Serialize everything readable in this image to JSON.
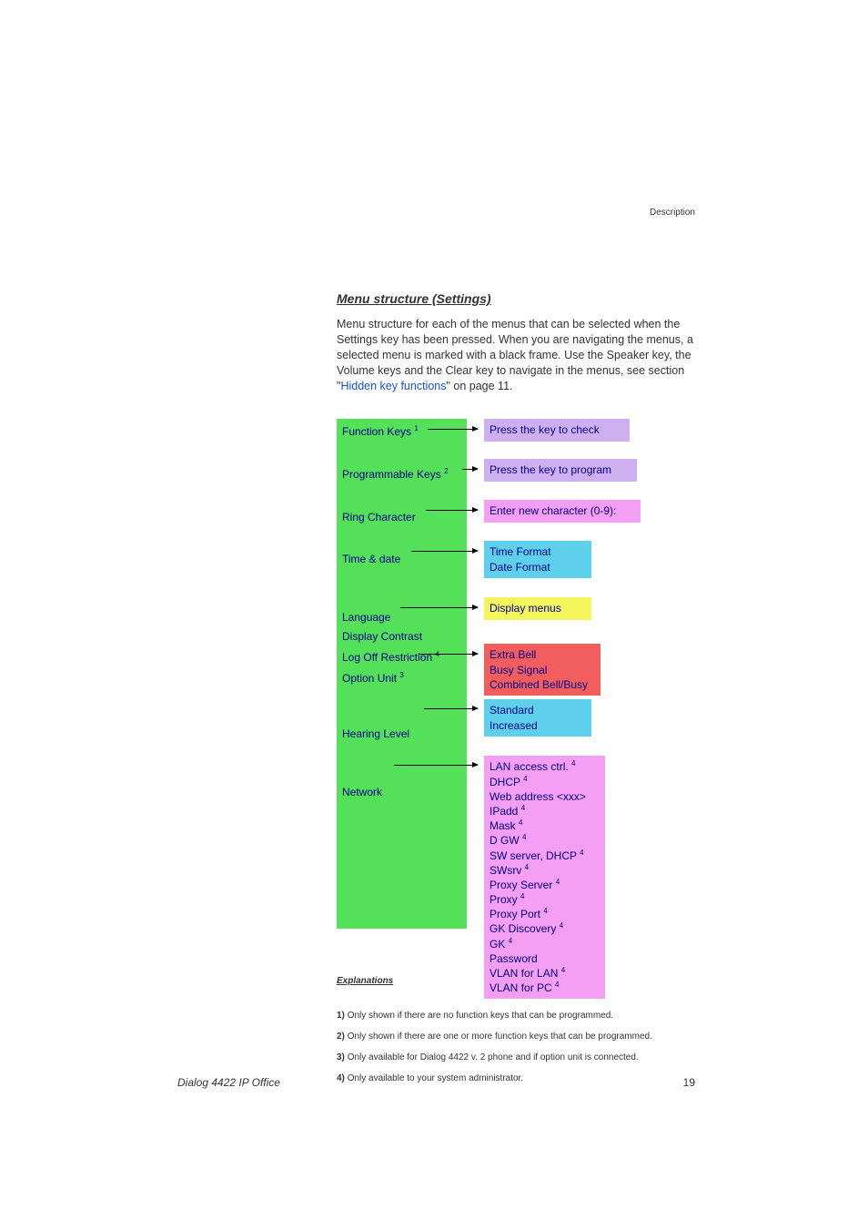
{
  "header": {
    "label": "Description"
  },
  "section": {
    "title": "Menu structure (Settings)",
    "intro_part1": "Menu structure for each of the menus that can be selected when the Settings key has been pressed. When you are navigating the menus, a selected menu is marked with a black frame. Use the Speaker key, the Volume keys and the Clear key to navigate in the menus, see section \"",
    "intro_link": "Hidden key functions",
    "intro_part2": "\" on page 11."
  },
  "menu": {
    "function_keys": "Function Keys",
    "function_keys_sup": "1",
    "programmable_keys": "Programmable Keys",
    "programmable_keys_sup": "2",
    "ring_character": "Ring Character",
    "time_date": "Time & date",
    "language": "Language",
    "display_contrast": "Display Contrast",
    "log_off_restriction": "Log Off Restriction",
    "log_off_restriction_sup": "4",
    "option_unit": "Option Unit",
    "option_unit_sup": "3",
    "hearing_level": "Hearing Level",
    "network": "Network"
  },
  "boxes": {
    "press_check": "Press the key to check",
    "press_program": "Press the key to program",
    "enter_char": "Enter new character (0-9):",
    "time_format": "Time Format",
    "date_format": "Date Format",
    "display_menus": "Display menus",
    "extra_bell": "Extra Bell",
    "busy_signal": "Busy Signal",
    "combined_bell": "Combined Bell/Busy",
    "standard": "Standard",
    "increased": "Increased",
    "lan_access": "LAN access ctrl.",
    "dhcp": "DHCP",
    "web_address": "Web address <xxx>",
    "ipadd": "IPadd",
    "mask": "Mask",
    "dgw": "D GW",
    "sw_server": "SW server, DHCP",
    "swsrv": "SWsrv",
    "proxy_server": "Proxy Server",
    "proxy": "Proxy",
    "proxy_port": "Proxy Port",
    "gk_discovery": "GK Discovery",
    "gk": "GK",
    "password": "Password",
    "vlan_lan": "VLAN for LAN",
    "vlan_pc": "VLAN for PC",
    "sup4": "4"
  },
  "explanations": {
    "title": "Explanations",
    "fn1_num": "1)",
    "fn1": "Only shown if there are no function keys that can be programmed.",
    "fn2_num": "2)",
    "fn2": "Only shown if there are one or more function keys that can be programmed.",
    "fn3_num": "3)",
    "fn3": "Only available for Dialog 4422 v. 2 phone and if option unit is connected.",
    "fn4_num": "4)",
    "fn4": "Only available to your system administrator."
  },
  "footer": {
    "left": "Dialog 4422 IP Office",
    "right": "19"
  }
}
